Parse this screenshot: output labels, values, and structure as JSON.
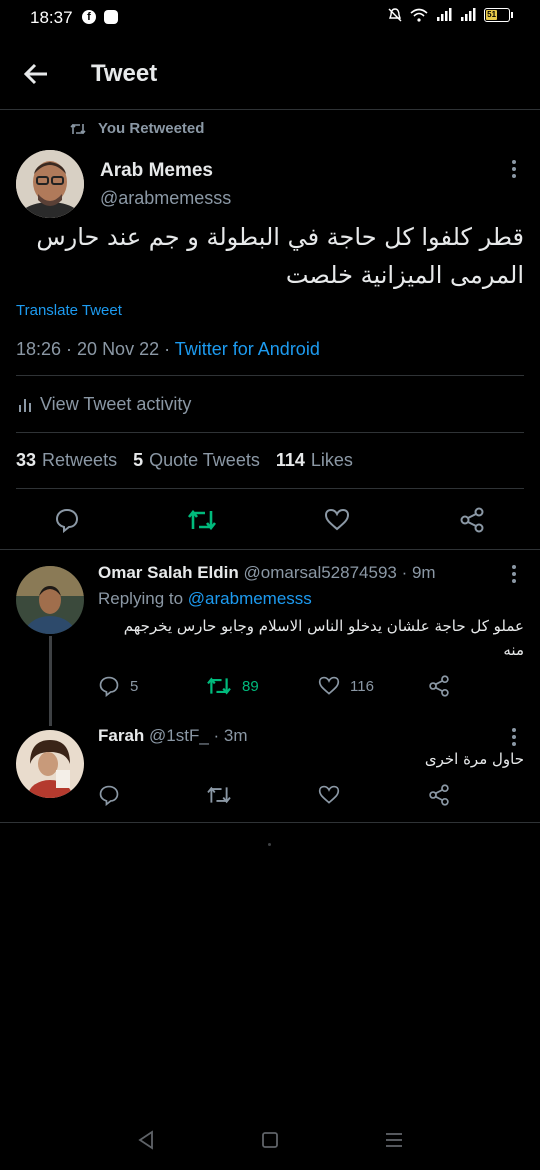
{
  "status": {
    "time": "18:37",
    "battery_level": "51",
    "icons": [
      "facebook-icon",
      "messenger-icon",
      "mute-icon",
      "wifi-icon",
      "signal-icon",
      "signal-icon",
      "battery-icon"
    ]
  },
  "header": {
    "title": "Tweet",
    "back_icon": "arrow-left-icon"
  },
  "tweet": {
    "retweet_label": "You Retweeted",
    "author_name": "Arab Memes",
    "author_handle": "@arabmemesss",
    "text": "قطر كلفوا كل حاجة في البطولة و جم عند حارس المرمى الميزانية خلصت",
    "translate_label": "Translate Tweet",
    "timestamp": "18:26 · 20 Nov 22 · ",
    "source": "Twitter for Android",
    "activity_label": "View Tweet activity",
    "stats": {
      "retweets_count": "33",
      "retweets_label": "Retweets",
      "quotes_count": "5",
      "quotes_label": "Quote Tweets",
      "likes_count": "114",
      "likes_label": "Likes"
    },
    "actions": [
      "reply-icon",
      "retweet-icon",
      "like-icon",
      "share-icon"
    ],
    "retweet_active_color": "#00ba7c"
  },
  "replies": [
    {
      "name": "Omar Salah Eldin",
      "handle": "@omarsal52874593",
      "time": "· 9m",
      "replying_prefix": "Replying to ",
      "replying_handle": "@arabmemesss",
      "text": "عملو كل حاجة علشان يدخلو الناس الاسلام وجابو حارس يخرجهم منه",
      "reply_count": "5",
      "retweet_count": "89",
      "like_count": "116"
    },
    {
      "name": "Farah",
      "handle": "@1stF_",
      "time": "· 3m",
      "text": "حاول مرة اخرى",
      "reply_count": "",
      "retweet_count": "",
      "like_count": ""
    }
  ],
  "navigation": {
    "buttons": [
      "back-triangle-icon",
      "home-square-icon",
      "menu-lines-icon"
    ]
  },
  "colors": {
    "background": "#000000",
    "accent": "#1d9bf0",
    "secondary_text": "#8b98a5",
    "retweet_green": "#00ba7c"
  }
}
